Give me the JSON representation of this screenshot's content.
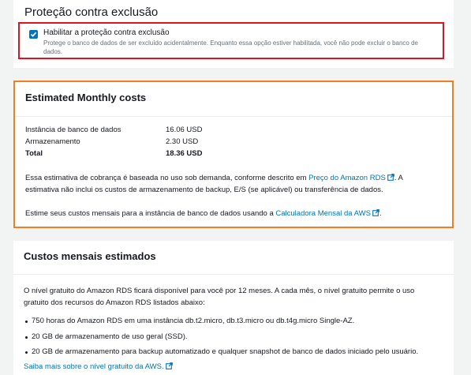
{
  "deletion_protection": {
    "title": "Proteção contra exclusão",
    "checkbox_checked": true,
    "checkbox_label": "Habilitar a proteção contra exclusão",
    "description": "Protege o banco de dados de ser excluído acidentalmente. Enquanto essa opção estiver habilitada, você não pode excluir o banco de dados."
  },
  "estimated_costs": {
    "title": "Estimated Monthly costs",
    "rows": [
      {
        "label": "Instância de banco de dados",
        "value": "16.06 USD"
      },
      {
        "label": "Armazenamento",
        "value": "2.30 USD"
      },
      {
        "label": "Total",
        "value": "18.36 USD"
      }
    ],
    "note_part1": "Essa estimativa de cobrança é baseada no uso sob demanda, conforme descrito em ",
    "note_link": "Preço do Amazon RDS",
    "note_part2": ". A estimativa não inclui os custos de armazenamento de backup, E/S (se aplicável) ou transferência de dados.",
    "estimate_part1": "Estime seus custos mensais para a instância de banco de dados usando a ",
    "estimate_link": "Calculadora Mensal da AWS",
    "estimate_part2": "."
  },
  "free_tier": {
    "title": "Custos mensais estimados",
    "intro": "O nível gratuito do Amazon RDS ficará disponível para você por 12 meses. A cada mês, o nível gratuito permite o uso gratuito dos recursos do Amazon RDS listados abaixo:",
    "bullets": [
      "750 horas do Amazon RDS em uma instância db.t2.micro, db.t3.micro ou db.t4g.micro Single-AZ.",
      "20 GB de armazenamento de uso geral (SSD).",
      "20 GB de armazenamento para backup automatizado e qualquer snapshot de banco de dados iniciado pelo usuário."
    ],
    "link": "Saiba mais sobre o nível gratuito da AWS."
  },
  "colors": {
    "link": "#0073bb",
    "highlight_red": "#e0131f",
    "highlight_orange": "#f57c1f"
  }
}
